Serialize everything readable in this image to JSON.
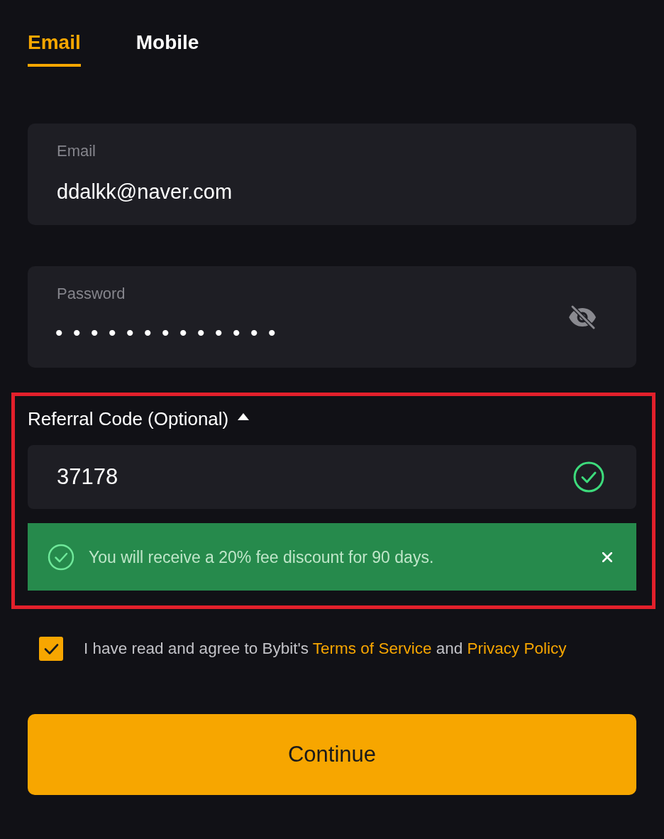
{
  "tabs": [
    {
      "label": "Email",
      "selected": true
    },
    {
      "label": "Mobile",
      "selected": false
    }
  ],
  "fields": [
    {
      "kind": "text",
      "label": "Email",
      "value": "ddalkk@naver.com"
    },
    {
      "kind": "password",
      "label": "Password",
      "value": "•••••••••••••"
    }
  ],
  "referral": {
    "label": "Referral Code (Optional)",
    "expanded": true,
    "highlighted": true,
    "value": "37178",
    "valid": true,
    "notice": {
      "text": "You will receive a 20% fee discount for 90 days."
    }
  },
  "agreement": {
    "checked": true,
    "parts": [
      {
        "kind": "text",
        "text": "I have read and agree to Bybit's"
      },
      {
        "kind": "link",
        "text": "Terms of Service"
      },
      {
        "kind": "text",
        "text": "and"
      },
      {
        "kind": "link",
        "text": "Privacy Policy"
      }
    ]
  },
  "submit_button": {
    "label": "Continue"
  }
}
